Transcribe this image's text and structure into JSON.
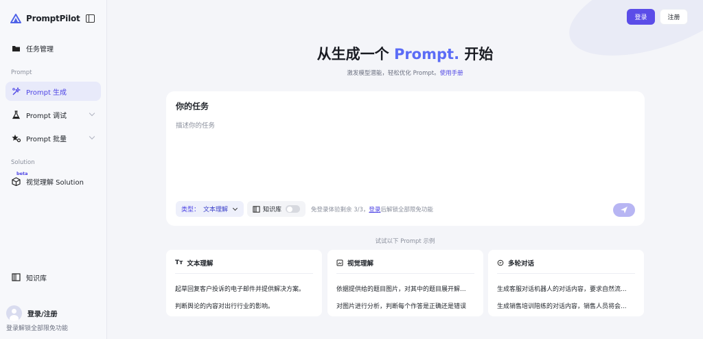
{
  "app": {
    "name": "PromptPilot"
  },
  "colors": {
    "accent": "#5b4de8",
    "accent_text": "#4f46e5",
    "active_bg": "#e8eafa",
    "send_disabled": "#b7b5f3"
  },
  "sidebar": {
    "collapse_icon": "sidebar-toggle-icon",
    "task_management": {
      "label": "任务管理",
      "icon": "folder-icon"
    },
    "section_prompt": "Prompt",
    "prompt_items": [
      {
        "label": "Prompt 生成",
        "icon": "magic-wand-icon",
        "active": true
      },
      {
        "label": "Prompt 调试",
        "icon": "flask-icon",
        "active": false
      },
      {
        "label": "Prompt 批量",
        "icon": "stars-icon",
        "active": false
      }
    ],
    "section_solution": "Solution",
    "solution_items": [
      {
        "label": "视觉理解 Solution",
        "badge": "beta",
        "icon": "cube-icon"
      }
    ],
    "knowledge_base": {
      "label": "知识库",
      "icon": "book-icon"
    },
    "user": {
      "name": "登录/注册",
      "subtitle": "登录解锁全部限免功能"
    }
  },
  "header": {
    "login": "登录",
    "register": "注册"
  },
  "hero": {
    "title_pre": "从生成一个",
    "title_accent": "Prompt.",
    "title_post": "开始",
    "subtitle": "激发模型潜能，轻松优化 Prompt。",
    "subtitle_link": "使用手册"
  },
  "task": {
    "title": "你的任务",
    "placeholder": "描述你的任务",
    "value": "",
    "type_label": "类型：",
    "type_value": "文本理解",
    "knowledge_label": "知识库",
    "knowledge_on": false,
    "trial_pre": "免登录体验剩余 3/3，",
    "trial_link": "登录",
    "trial_post": "后解锁全部限免功能"
  },
  "examples": {
    "label": "试试以下 Prompt 示例",
    "cards": [
      {
        "title": "文本理解",
        "icon": "text-icon",
        "lines": [
          "起草回复客户投诉的电子邮件并提供解决方案。",
          "判断舆论的内容对出行行业的影响。"
        ]
      },
      {
        "title": "视觉理解",
        "icon": "image-icon",
        "lines": [
          "依据提供给的题目图片，对其中的题目展开解...",
          "对图片进行分析，判断每个作答是正确还是错误"
        ]
      },
      {
        "title": "多轮对话",
        "icon": "chat-icon",
        "lines": [
          "生成客服对话机器人的对话内容，要求自然流...",
          "生成销售培训陪练的对话内容，销售人员将会..."
        ]
      }
    ]
  }
}
